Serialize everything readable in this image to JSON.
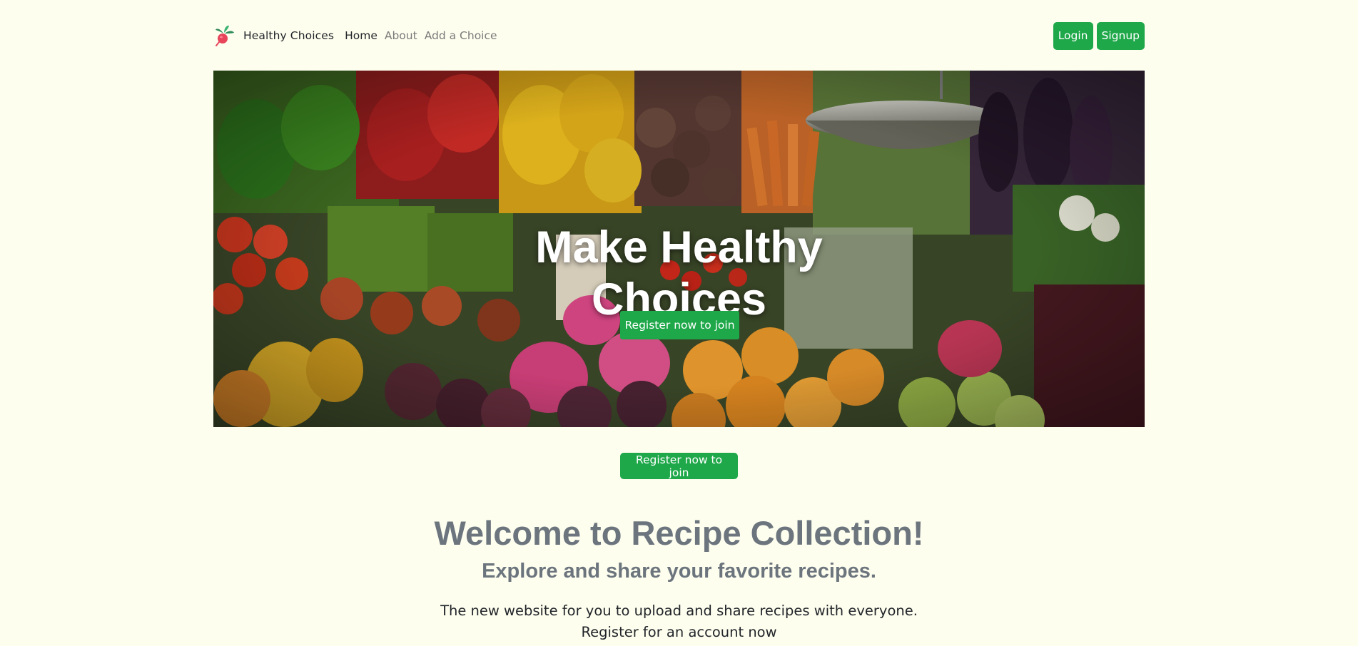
{
  "navbar": {
    "brand_text": "Healthy Choices",
    "logo_icon": "radish-icon",
    "links": [
      {
        "label": "Home",
        "active": true
      },
      {
        "label": "About",
        "active": false
      },
      {
        "label": "Add a Choice",
        "active": false
      }
    ],
    "login_label": "Login",
    "signup_label": "Signup"
  },
  "hero": {
    "title_line1": "Make Healthy",
    "title_line2": "Choices",
    "cta_label": "Register now to join",
    "image": "vegetable-market-photo"
  },
  "main": {
    "join_label": "Register now to join",
    "welcome_title": "Welcome to Recipe Collection!",
    "subtitle": "Explore and share your favorite recipes.",
    "lead_line1": "The new website for you to upload and share recipes with everyone.",
    "lead_line2": "Register for an account now"
  },
  "colors": {
    "background": "#fefeef",
    "accent_green": "#1fa84a",
    "muted_text": "#6c757d"
  }
}
